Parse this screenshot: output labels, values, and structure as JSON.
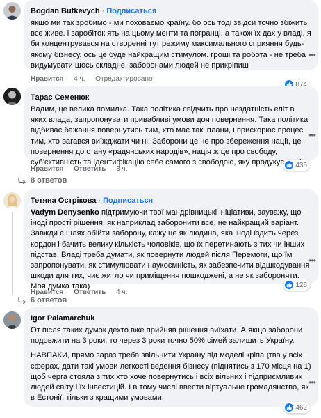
{
  "comments": [
    {
      "author": "Bogdan Butkevych",
      "follow_label": "Подписаться",
      "text": "якщо ми так зробимо - ми поховаємо країну. бо ось тоді звідси точно збіжить все живе. і заробіток ять на цьому менти та погранці. а також їх дах у владі. я би концентрувався на створенні тут режиму максимального сприяння будь-якому бізнесу. ось це буде найкращим стимулом. гроші та робота - не треба видумувати щось складне. заборонами людей не прикріпиш",
      "actions": {
        "like": "Нравится",
        "time": "4 ч.",
        "edited": "Отредактировано"
      },
      "reaction_count": "874"
    },
    {
      "author": "Тарас Семенюк",
      "follow_label": "",
      "text": "Вадим, це велика помилка. Така політика свідчить про нездатність еліт в яких влада, запропонувати привабливі умови доя повернення. Така політика відбиває бажання повернутись тим, хто має такі плани, і прискорює процес тим, хто вагався виїжджати чи ні. Заборони це не про збереження нації, це повернення до стану «радянських народів», нація ж це про свободу, суб'єктивність та ідентифікацію себе самого з свободою, яку продукує нація.",
      "actions": {
        "like": "Нравится",
        "reply": "Ответить",
        "time": "3 ч."
      },
      "reaction_count": "435",
      "replies_label": "8 ответов"
    },
    {
      "author": "Тетяна Острікова",
      "follow_label": "Подписаться",
      "mention": "Vadym Denysenko",
      "text": " підтримуючи твої мандрівницькі ініціативи, зауважу, що іноді прості рішення, як наприклад заборонити все, не найкращий варіант. Завжди є шлях обійти заборону, кажу це як людина, яка іноді їздить через кордон і бачить велику кількість чоловіків, що їх перетинають з тих чи інших підстав. Владі треба думати, як повернути людей після Перемоги, що їм запропонувати, як стимулювати наукоємність, як забезпечити відшкодування шкоди для тих, чиє житло чи приміщення пошкоджені, а не як забороняти. Моя думка така)",
      "actions": {
        "like": "Нравится",
        "reply": "Ответить",
        "time": "4 ч."
      },
      "reaction_count": "126",
      "replies_label": "6 ответов"
    },
    {
      "author": "Igor Palamarchuk",
      "follow_label": "",
      "paragraphs": [
        "От після таких думок дехто вже прийняв рішення виїхати. А якщо заборони подовжити на 3 роки, то через 3 роки точно 50% сімей залишить Україну.",
        "НАВПАКИ, прямо зараз треба звільнити Україну від моделі кріпацтва у всіх сферах, дати такі умови легкості ведення бізнесу (піднятись з 170 місця на 1) щоб черга стояла з тих хто хоче повернутись і всіх вільних і підприємливих людей світу і їх інвестицій. І в тому числі ввести віртуальне громадянство, як в Естонії, тільки з кращими умовами."
      ],
      "reaction_count": "462"
    }
  ],
  "colors": {
    "link": "#1b74e4",
    "bubble": "#f0f2f5",
    "meta": "#65676b",
    "like": "#1877f2"
  }
}
